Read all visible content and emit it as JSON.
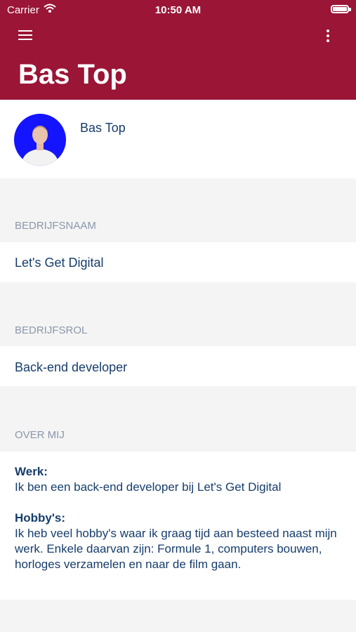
{
  "status_bar": {
    "carrier": "Carrier",
    "time": "10:50 AM"
  },
  "app_bar": {
    "title": "Bas Top",
    "menu_icon": "hamburger-menu-icon",
    "more_icon": "more-vertical-icon",
    "color": "#9a1536"
  },
  "profile": {
    "name": "Bas Top",
    "avatar_bg": "#1414ff"
  },
  "sections": {
    "company": {
      "label": "BEDRIJFSNAAM",
      "value": "Let's Get Digital"
    },
    "role": {
      "label": "BEDRIJFSROL",
      "value": "Back-end developer"
    },
    "about": {
      "label": "OVER MIJ",
      "work_heading": "Werk:",
      "work_text": "Ik ben een back-end developer bij Let's Get Digital",
      "hobby_heading": "Hobby's:",
      "hobby_text": "Ik heb veel hobby's waar ik graag tijd aan besteed naast mijn werk. Enkele daarvan zijn: Formule 1, computers bouwen, horloges verzamelen en naar de film gaan."
    }
  },
  "colors": {
    "text": "#163d6b",
    "section_label": "#8a97aa",
    "background": "#f4f4f4"
  }
}
